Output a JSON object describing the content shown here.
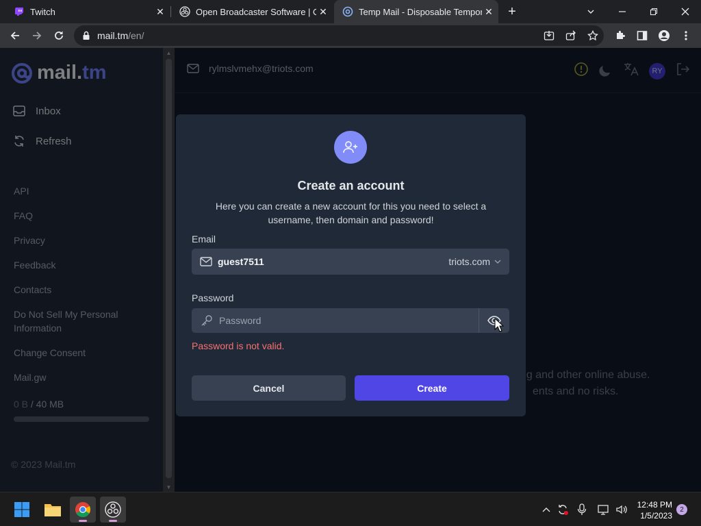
{
  "browser": {
    "tabs": [
      {
        "title": "Twitch",
        "favicon": "twitch-icon",
        "active": false
      },
      {
        "title": "Open Broadcaster Software | OBS",
        "favicon": "obs-icon",
        "active": false
      },
      {
        "title": "Temp Mail - Disposable Tempora",
        "favicon": "mailtm-at-icon",
        "active": true
      }
    ],
    "url_host": "mail.tm",
    "url_path": "/en/"
  },
  "sidebar": {
    "logo_main": "mail.",
    "logo_accent": "tm",
    "nav": [
      {
        "label": "Inbox",
        "icon": "inbox-icon"
      },
      {
        "label": "Refresh",
        "icon": "refresh-icon"
      }
    ],
    "links": [
      "API",
      "FAQ",
      "Privacy",
      "Feedback",
      "Contacts",
      "Do Not Sell My Personal Information",
      "Change Consent",
      "Mail.gw"
    ],
    "storage_used": "0 B",
    "storage_total": " / 40 MB",
    "storage_fraction": 0,
    "copyright": "© 2023 Mail.tm"
  },
  "header": {
    "account_email": "rylmslvmehx@triots.com",
    "avatar_initials": "RY"
  },
  "background_text": {
    "line1": "ng and other online abuse.",
    "line2": "ents and no risks."
  },
  "modal": {
    "title": "Create an account",
    "description": "Here you can create a new account for this you need to select a username, then domain and password!",
    "email_label": "Email",
    "email_username": "guest7511",
    "email_domain": "triots.com",
    "password_label": "Password",
    "password_placeholder": "Password",
    "password_value": "",
    "error": "Password is not valid.",
    "cancel_label": "Cancel",
    "create_label": "Create"
  },
  "taskbar": {
    "time": "12:48 PM",
    "date": "1/5/2023",
    "notification_count": "2"
  },
  "colors": {
    "accent": "#4f46e5",
    "accent_light": "#818cf8",
    "error": "#f87171",
    "page_bg": "#111827",
    "panel_bg": "#1f2937"
  }
}
